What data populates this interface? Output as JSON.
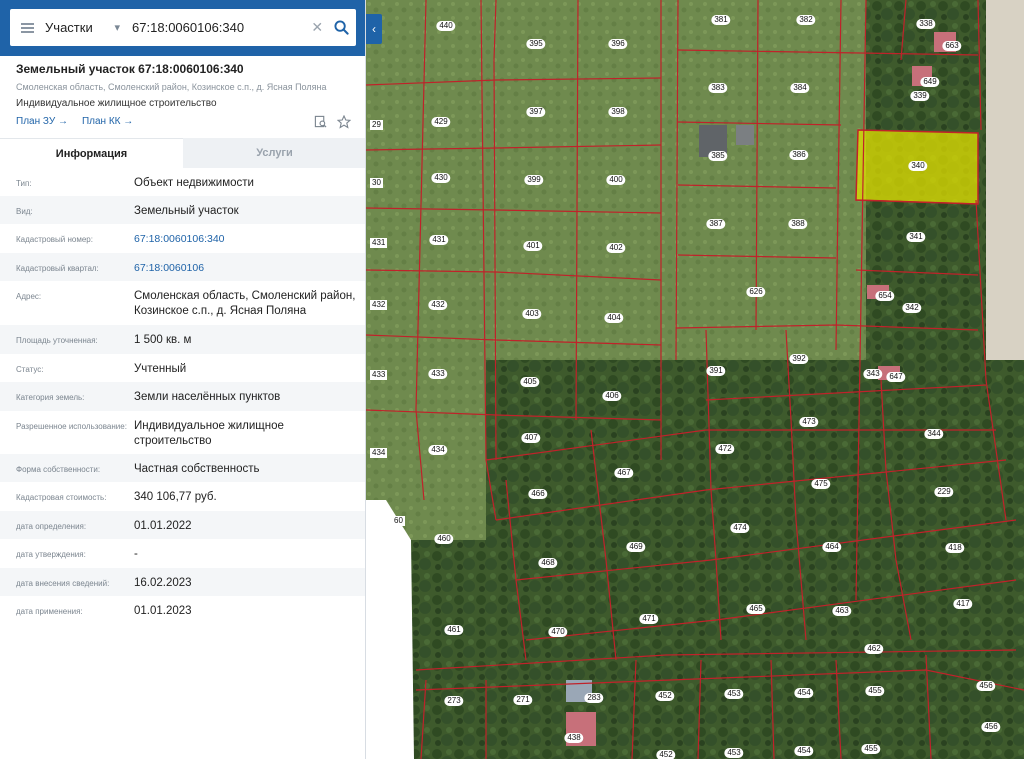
{
  "search": {
    "type_label": "Участки",
    "query": "67:18:0060106:340"
  },
  "parcel": {
    "title": "Земельный участок 67:18:0060106:340",
    "address_short": "Смоленская область, Смоленский район, Козинское с.п., д. Ясная Поляна",
    "purpose": "Индивидуальное жилищное строительство",
    "link_plan_zu": "План ЗУ →",
    "link_plan_kk": "План КК →"
  },
  "tabs": {
    "info": "Информация",
    "services": "Услуги"
  },
  "properties": [
    {
      "label": "Тип:",
      "value": "Объект недвижимости",
      "link": false
    },
    {
      "label": "Вид:",
      "value": "Земельный участок",
      "link": false
    },
    {
      "label": "Кадастровый номер:",
      "value": "67:18:0060106:340",
      "link": true
    },
    {
      "label": "Кадастровый квартал:",
      "value": "67:18:0060106",
      "link": true
    },
    {
      "label": "Адрес:",
      "value": "Смоленская область, Смоленский район, Козинское с.п., д. Ясная Поляна",
      "link": false
    },
    {
      "label": "Площадь уточненная:",
      "value": "1 500 кв. м",
      "link": false
    },
    {
      "label": "Статус:",
      "value": "Учтенный",
      "link": false
    },
    {
      "label": "Категория земель:",
      "value": "Земли населённых пунктов",
      "link": false
    },
    {
      "label": "Разрешенное использование:",
      "value": "Индивидуальное жилищное строительство",
      "link": false
    },
    {
      "label": "Форма собственности:",
      "value": "Частная собственность",
      "link": false
    },
    {
      "label": "Кадастровая стоимость:",
      "value": "340 106,77 руб.",
      "link": false
    },
    {
      "label": "дата определения:",
      "value": "01.01.2022",
      "link": false
    },
    {
      "label": "дата утверждения:",
      "value": "-",
      "link": false
    },
    {
      "label": "дата внесения сведений:",
      "value": "16.02.2023",
      "link": false
    },
    {
      "label": "дата применения:",
      "value": "01.01.2023",
      "link": false
    }
  ],
  "map": {
    "colors": {
      "boundary": "#c0222a",
      "selected_fill": "#e0e000",
      "ui_blue": "#1f63a8"
    },
    "plots": [
      "440",
      "395",
      "396",
      "381",
      "382",
      "338",
      "663",
      "649",
      "339",
      "429",
      "397",
      "398",
      "383",
      "384",
      "385",
      "386",
      "340",
      "430",
      "399",
      "400",
      "431",
      "401",
      "402",
      "387",
      "388",
      "341",
      "432",
      "403",
      "404",
      "626",
      "654",
      "342",
      "433",
      "405",
      "391",
      "392",
      "343",
      "647",
      "406",
      "473",
      "434",
      "407",
      "472",
      "344",
      "467",
      "466",
      "475",
      "229",
      "460",
      "474",
      "464",
      "418",
      "468",
      "469",
      "465",
      "463",
      "417",
      "461",
      "470",
      "471",
      "462",
      "273",
      "271",
      "283",
      "452",
      "453",
      "454",
      "455",
      "456",
      "438",
      "452",
      "453",
      "454",
      "455",
      "456"
    ],
    "edge_labels": [
      "29",
      "30",
      "431",
      "432",
      "433",
      "434",
      "60"
    ]
  }
}
